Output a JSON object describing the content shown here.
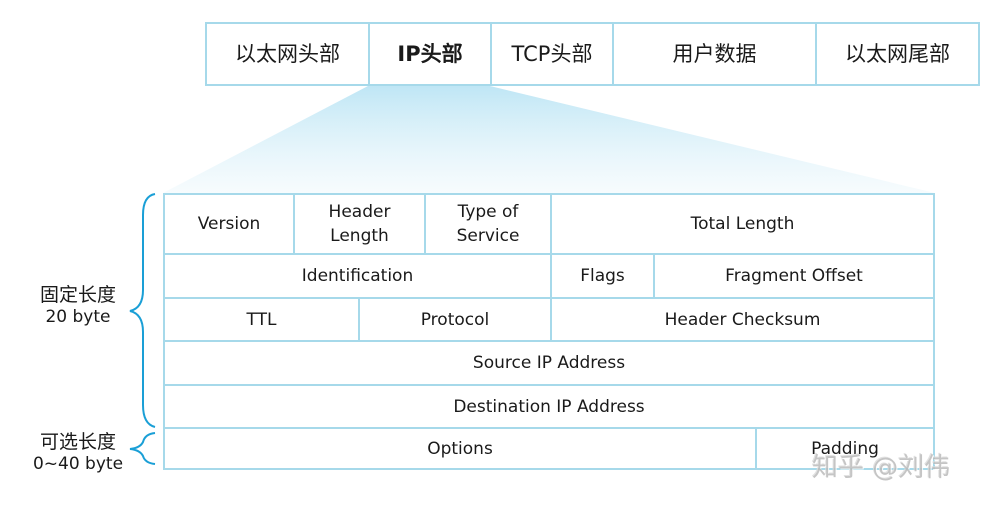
{
  "frame": [
    "以太网头部",
    "IP头部",
    "TCP头部",
    "用户数据",
    "以太网尾部"
  ],
  "header": {
    "row1": [
      "Version",
      "Header\nLength",
      "Type of\nService",
      "Total Length"
    ],
    "row2": [
      "Identification",
      "Flags",
      "Fragment Offset"
    ],
    "row3": [
      "TTL",
      "Protocol",
      "Header Checksum"
    ],
    "row4": "Source IP Address",
    "row5": "Destination IP Address",
    "row6": [
      "Options",
      "Padding"
    ]
  },
  "labels": {
    "fixed_title": "固定长度",
    "fixed_size": "20 byte",
    "optional_title": "可选长度",
    "optional_size": "0~40 byte"
  },
  "watermark": "知乎 @刘伟",
  "colors": {
    "border": "#a6d9ea",
    "brace": "#1a9fd6"
  }
}
